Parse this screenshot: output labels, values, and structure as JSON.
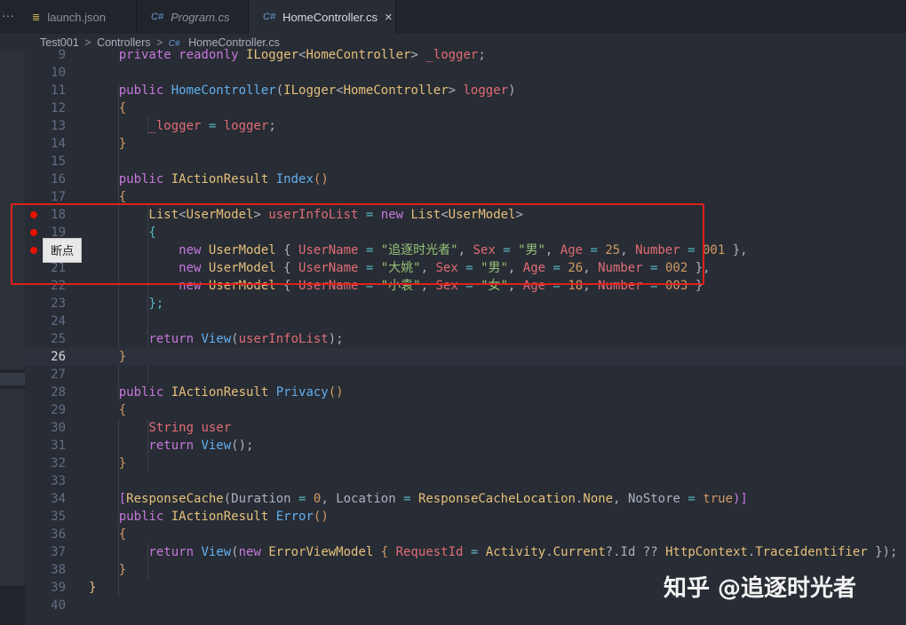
{
  "tabs": [
    {
      "icon": "json-file-icon",
      "icon_glyph": "≣",
      "label": "launch.json",
      "italic": false
    },
    {
      "icon": "csharp-file-icon",
      "icon_glyph": "C#",
      "label": "Program.cs",
      "italic": true
    },
    {
      "icon": "csharp-file-icon",
      "icon_glyph": "C#",
      "label": "HomeController.cs",
      "italic": false,
      "active": true,
      "close": "×"
    }
  ],
  "tab_more": "···",
  "breadcrumb": {
    "parts": [
      "Test001",
      "Controllers"
    ],
    "separator": ">",
    "file_icon": "C#",
    "file": "HomeController.cs"
  },
  "tooltip": "断点",
  "watermark": "知乎 @追逐时光者",
  "colors": {
    "breakpoint": "#e51400",
    "highlight_box": "#e0201c",
    "keyword": "#c678dd",
    "type": "#e5c07b",
    "function": "#61afef",
    "variable": "#e06c75",
    "string": "#98c379",
    "number": "#d19a66"
  },
  "editor": {
    "current_line": 26,
    "breakpoints": [
      18,
      19,
      20
    ],
    "lines": [
      {
        "n": "9",
        "tokens": [
          [
            "    private readonly ",
            "k"
          ],
          [
            "ILogger",
            "t"
          ],
          [
            "<",
            "p"
          ],
          [
            "HomeController",
            "t"
          ],
          [
            "> ",
            "p"
          ],
          [
            "_logger",
            "v"
          ],
          [
            ";",
            "p"
          ]
        ]
      },
      {
        "n": "10",
        "tokens": []
      },
      {
        "n": "11",
        "tokens": [
          [
            "    public ",
            "k"
          ],
          [
            "HomeController",
            "f"
          ],
          [
            "(",
            "p"
          ],
          [
            "ILogger",
            "t"
          ],
          [
            "<",
            "p"
          ],
          [
            "HomeController",
            "t"
          ],
          [
            "> ",
            "p"
          ],
          [
            "logger",
            "v"
          ],
          [
            ")",
            "p"
          ]
        ]
      },
      {
        "n": "12",
        "tokens": [
          [
            "    {",
            "n"
          ]
        ]
      },
      {
        "n": "13",
        "tokens": [
          [
            "        _logger",
            "v"
          ],
          [
            " = ",
            "o"
          ],
          [
            "logger",
            "v"
          ],
          [
            ";",
            "p"
          ]
        ]
      },
      {
        "n": "14",
        "tokens": [
          [
            "    }",
            "n"
          ]
        ]
      },
      {
        "n": "15",
        "tokens": []
      },
      {
        "n": "16",
        "tokens": [
          [
            "    public ",
            "k"
          ],
          [
            "IActionResult ",
            "t"
          ],
          [
            "Index",
            "f"
          ],
          [
            "()",
            "n"
          ]
        ]
      },
      {
        "n": "17",
        "tokens": [
          [
            "    {",
            "n"
          ]
        ]
      },
      {
        "n": "18",
        "tokens": [
          [
            "        List",
            "t"
          ],
          [
            "<",
            "p"
          ],
          [
            "UserModel",
            "t"
          ],
          [
            "> ",
            "p"
          ],
          [
            "userInfoList",
            "v"
          ],
          [
            " = ",
            "o"
          ],
          [
            "new ",
            "k"
          ],
          [
            "List",
            "t"
          ],
          [
            "<",
            "p"
          ],
          [
            "UserModel",
            "t"
          ],
          [
            ">",
            "p"
          ]
        ]
      },
      {
        "n": "19",
        "tokens": [
          [
            "        {",
            "o"
          ]
        ]
      },
      {
        "n": "20",
        "tokens": [
          [
            "            new ",
            "k"
          ],
          [
            "UserModel ",
            "t"
          ],
          [
            "{ ",
            "p"
          ],
          [
            "UserName",
            "v"
          ],
          [
            " = ",
            "o"
          ],
          [
            "\"追逐时光者\"",
            "s"
          ],
          [
            ", ",
            "p"
          ],
          [
            "Sex",
            "v"
          ],
          [
            " = ",
            "o"
          ],
          [
            "\"男\"",
            "s"
          ],
          [
            ", ",
            "p"
          ],
          [
            "Age",
            "v"
          ],
          [
            " = ",
            "o"
          ],
          [
            "25",
            "n"
          ],
          [
            ", ",
            "p"
          ],
          [
            "Number",
            "v"
          ],
          [
            " = ",
            "o"
          ],
          [
            "001",
            "n"
          ],
          [
            " },",
            "p"
          ]
        ]
      },
      {
        "n": "21",
        "tokens": [
          [
            "            new ",
            "k"
          ],
          [
            "UserModel ",
            "t"
          ],
          [
            "{ ",
            "p"
          ],
          [
            "UserName",
            "v"
          ],
          [
            " = ",
            "o"
          ],
          [
            "\"大姚\"",
            "s"
          ],
          [
            ", ",
            "p"
          ],
          [
            "Sex",
            "v"
          ],
          [
            " = ",
            "o"
          ],
          [
            "\"男\"",
            "s"
          ],
          [
            ", ",
            "p"
          ],
          [
            "Age",
            "v"
          ],
          [
            " = ",
            "o"
          ],
          [
            "26",
            "n"
          ],
          [
            ", ",
            "p"
          ],
          [
            "Number",
            "v"
          ],
          [
            " = ",
            "o"
          ],
          [
            "002",
            "n"
          ],
          [
            " },",
            "p"
          ]
        ]
      },
      {
        "n": "22",
        "tokens": [
          [
            "            new ",
            "k"
          ],
          [
            "UserModel ",
            "t"
          ],
          [
            "{ ",
            "p"
          ],
          [
            "UserName",
            "v"
          ],
          [
            " = ",
            "o"
          ],
          [
            "\"小袁\"",
            "s"
          ],
          [
            ", ",
            "p"
          ],
          [
            "Sex",
            "v"
          ],
          [
            " = ",
            "o"
          ],
          [
            "\"女\"",
            "s"
          ],
          [
            ", ",
            "p"
          ],
          [
            "Age",
            "v"
          ],
          [
            " = ",
            "o"
          ],
          [
            "18",
            "n"
          ],
          [
            ", ",
            "p"
          ],
          [
            "Number",
            "v"
          ],
          [
            " = ",
            "o"
          ],
          [
            "003",
            "n"
          ],
          [
            " }",
            "p"
          ]
        ]
      },
      {
        "n": "23",
        "tokens": [
          [
            "        };",
            "o"
          ]
        ]
      },
      {
        "n": "24",
        "tokens": []
      },
      {
        "n": "25",
        "tokens": [
          [
            "        return ",
            "k"
          ],
          [
            "View",
            "f"
          ],
          [
            "(",
            "p"
          ],
          [
            "userInfoList",
            "v"
          ],
          [
            ");",
            "p"
          ]
        ]
      },
      {
        "n": "26",
        "tokens": [
          [
            "    }",
            "n"
          ]
        ]
      },
      {
        "n": "27",
        "tokens": []
      },
      {
        "n": "28",
        "tokens": [
          [
            "    public ",
            "k"
          ],
          [
            "IActionResult ",
            "t"
          ],
          [
            "Privacy",
            "f"
          ],
          [
            "()",
            "n"
          ]
        ]
      },
      {
        "n": "29",
        "tokens": [
          [
            "    {",
            "n"
          ]
        ]
      },
      {
        "n": "30",
        "tokens": [
          [
            "        String ",
            "v"
          ],
          [
            "user",
            "v"
          ]
        ]
      },
      {
        "n": "31",
        "tokens": [
          [
            "        return ",
            "k"
          ],
          [
            "View",
            "f"
          ],
          [
            "();",
            "p"
          ]
        ]
      },
      {
        "n": "32",
        "tokens": [
          [
            "    }",
            "n"
          ]
        ]
      },
      {
        "n": "33",
        "tokens": []
      },
      {
        "n": "34",
        "tokens": [
          [
            "    [",
            "k"
          ],
          [
            "ResponseCache",
            "t"
          ],
          [
            "(",
            "p"
          ],
          [
            "Duration",
            "p"
          ],
          [
            " = ",
            "o"
          ],
          [
            "0",
            "n"
          ],
          [
            ", ",
            "p"
          ],
          [
            "Location",
            "p"
          ],
          [
            " = ",
            "o"
          ],
          [
            "ResponseCacheLocation",
            "t"
          ],
          [
            ".",
            "p"
          ],
          [
            "None",
            "t"
          ],
          [
            ", ",
            "p"
          ],
          [
            "NoStore",
            "p"
          ],
          [
            " = ",
            "o"
          ],
          [
            "true",
            "n"
          ],
          [
            ")]",
            "k"
          ]
        ]
      },
      {
        "n": "35",
        "tokens": [
          [
            "    public ",
            "k"
          ],
          [
            "IActionResult ",
            "t"
          ],
          [
            "Error",
            "f"
          ],
          [
            "()",
            "n"
          ]
        ]
      },
      {
        "n": "36",
        "tokens": [
          [
            "    {",
            "n"
          ]
        ]
      },
      {
        "n": "37",
        "tokens": [
          [
            "        return ",
            "k"
          ],
          [
            "View",
            "f"
          ],
          [
            "(",
            "p"
          ],
          [
            "new ",
            "k"
          ],
          [
            "ErrorViewModel ",
            "t"
          ],
          [
            "{ ",
            "n"
          ],
          [
            "RequestId",
            "v"
          ],
          [
            " = ",
            "o"
          ],
          [
            "Activity",
            "t"
          ],
          [
            ".",
            "p"
          ],
          [
            "Current",
            "t"
          ],
          [
            "?.",
            "p"
          ],
          [
            "Id",
            "p"
          ],
          [
            " ?? ",
            "p"
          ],
          [
            "HttpContext",
            "t"
          ],
          [
            ".",
            "p"
          ],
          [
            "TraceIdentifier",
            "t"
          ],
          [
            " });",
            "p"
          ]
        ]
      },
      {
        "n": "38",
        "tokens": [
          [
            "    }",
            "n"
          ]
        ]
      },
      {
        "n": "39",
        "tokens": [
          [
            "}",
            "t"
          ]
        ]
      },
      {
        "n": "40",
        "tokens": []
      }
    ]
  }
}
